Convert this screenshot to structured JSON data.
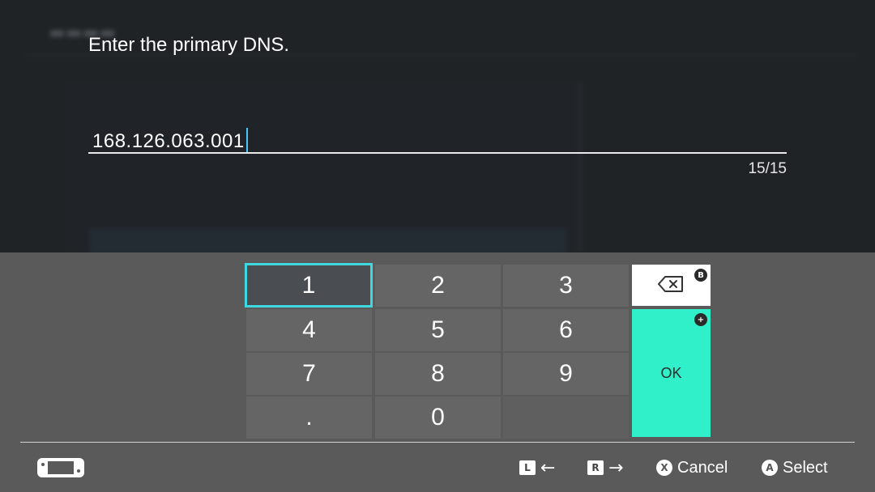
{
  "dialog": {
    "prompt": "Enter the primary DNS.",
    "input_value": "168.126.063.001",
    "char_counter": "15/15"
  },
  "keypad": {
    "keys": [
      "1",
      "2",
      "3",
      "4",
      "5",
      "6",
      "7",
      "8",
      "9",
      ".",
      "0"
    ],
    "selected_key": "1",
    "backspace_badge": "B",
    "ok_label": "OK",
    "ok_badge": "+",
    "accent_color": "#2ff0c8",
    "focus_color": "#3fd7e0"
  },
  "footer": {
    "console_icon": "handheld-console-icon",
    "hint_left": {
      "button": "L",
      "arrow": "←"
    },
    "hint_right": {
      "button": "R",
      "arrow": "→"
    },
    "hint_cancel": {
      "button": "X",
      "label": "Cancel"
    },
    "hint_select": {
      "button": "A",
      "label": "Select"
    }
  }
}
